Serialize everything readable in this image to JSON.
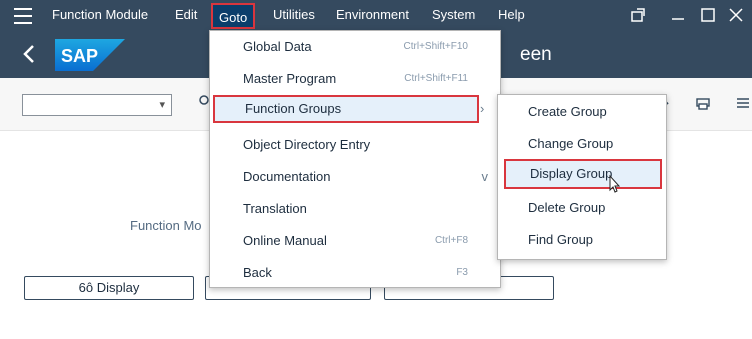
{
  "menubar": {
    "items": [
      "Function Module",
      "Edit",
      "Goto",
      "Utilities",
      "Environment",
      "System",
      "Help"
    ],
    "active": "Goto"
  },
  "shell": {
    "title_fragment": "een",
    "logo_text": "SAP"
  },
  "page": {
    "field_label": "Function Mo",
    "display_button": "Display"
  },
  "goto_menu": {
    "items": [
      {
        "label": "Global Data",
        "shortcut": "Ctrl+Shift+F10"
      },
      {
        "label": "Master Program",
        "shortcut": "Ctrl+Shift+F11"
      },
      {
        "label": "Function Groups",
        "submenu": true
      },
      {
        "label": "Object Directory Entry"
      },
      {
        "label": "Documentation",
        "submenu": true
      },
      {
        "label": "Translation"
      },
      {
        "label": "Online Manual",
        "shortcut": "Ctrl+F8"
      },
      {
        "label": "Back",
        "shortcut": "F3"
      }
    ]
  },
  "fg_submenu": {
    "items": [
      "Create Group",
      "Change Group",
      "Display Group",
      "Delete Group",
      "Find Group"
    ],
    "highlighted": "Display Group"
  },
  "colors": {
    "shell": "#354a5f",
    "highlight_border": "#d9363e",
    "highlight_bg": "#e5f0fa"
  }
}
